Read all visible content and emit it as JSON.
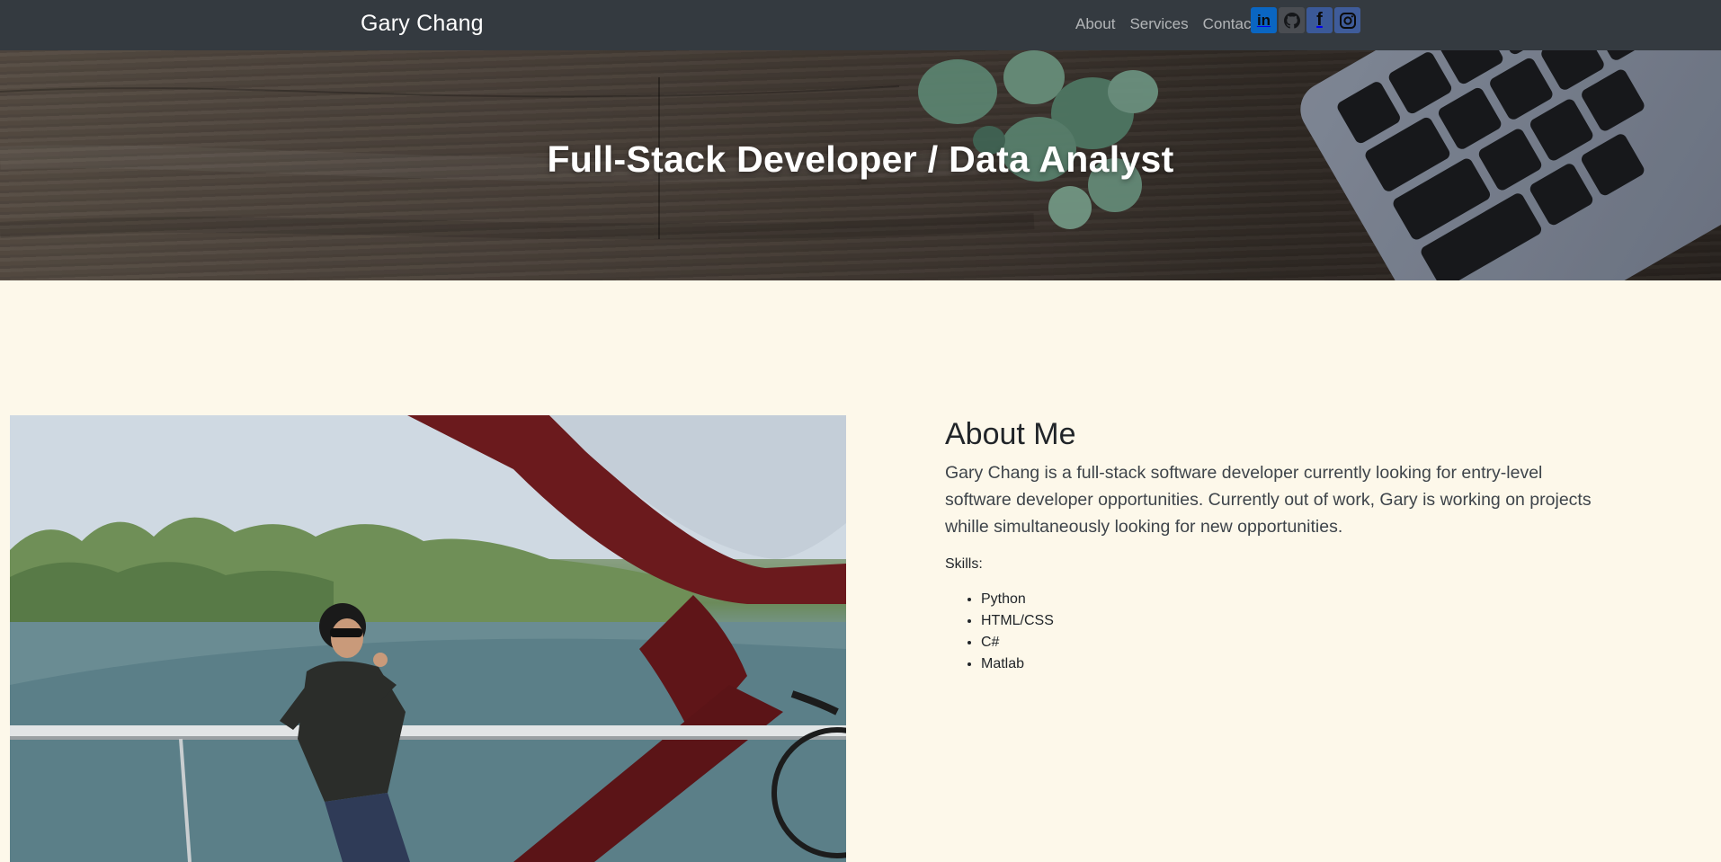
{
  "navbar": {
    "brand": "Gary Chang",
    "links": [
      {
        "label": "About"
      },
      {
        "label": "Services"
      },
      {
        "label": "Contact"
      }
    ],
    "socials": [
      {
        "name": "linkedin-icon",
        "glyph": "in"
      },
      {
        "name": "github-icon"
      },
      {
        "name": "facebook-icon",
        "glyph": "f"
      },
      {
        "name": "instagram-icon"
      }
    ]
  },
  "hero": {
    "title": "Full-Stack Developer / Data Analyst"
  },
  "about": {
    "heading": "About Me",
    "lead": "Gary Chang is a full-stack software developer currently looking for entry-level software developer opportunities. Currently out of work, Gary is working on projects whille simultaneously looking for new opportunities.",
    "skills_label": "Skills:",
    "skills": [
      "Python",
      "HTML/CSS",
      "C#",
      "Matlab"
    ]
  },
  "colors": {
    "navbar_bg": "#343a40",
    "page_bg": "#fdf8ea",
    "linkedin": "#0a66c2",
    "facebook": "#3b5998"
  }
}
